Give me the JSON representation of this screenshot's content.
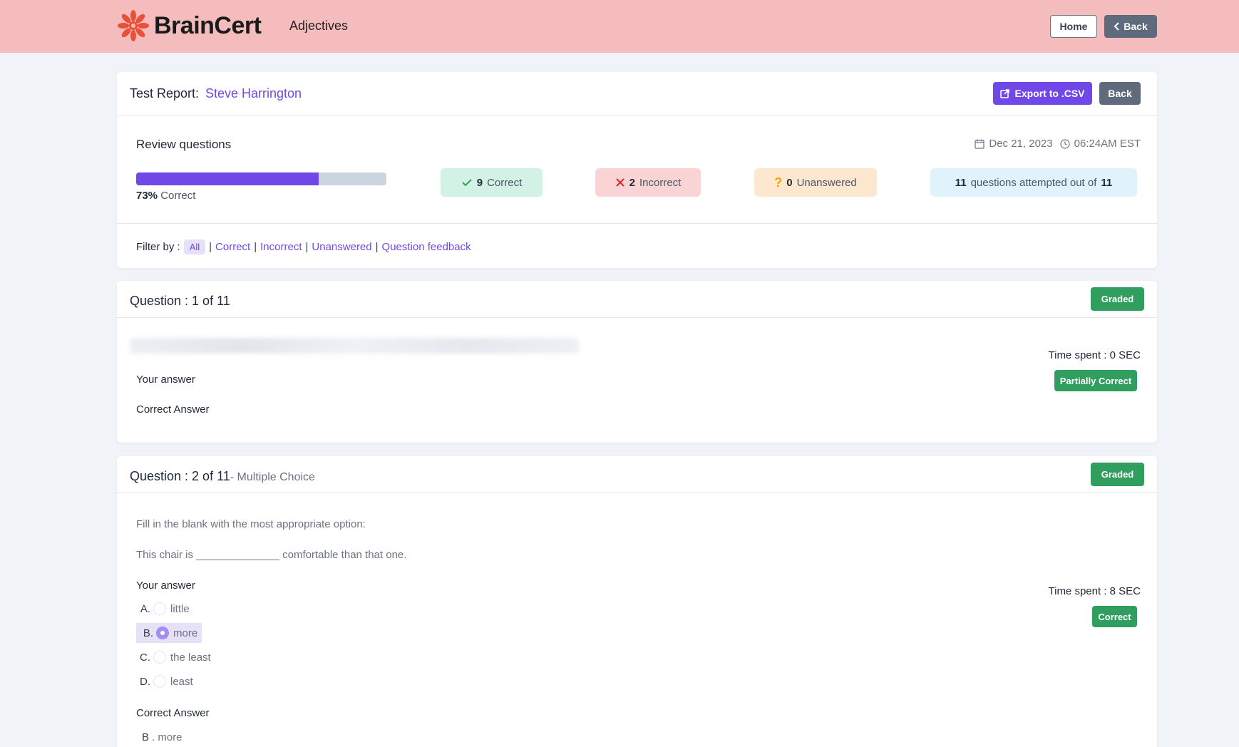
{
  "header": {
    "logo_text": "BrainCert",
    "course_title": "Adjectives",
    "home_label": "Home",
    "back_label": "Back"
  },
  "report": {
    "label": "Test Report:",
    "student_name": "Steve Harrington",
    "export_label": "Export to .CSV",
    "back_label": "Back",
    "review_title": "Review questions",
    "date": "Dec 21, 2023",
    "time": "06:24AM EST",
    "progress_fraction": 0.73,
    "percent": "73%",
    "percent_suffix": "Correct",
    "stats": {
      "correct_count": "9",
      "correct_label": "Correct",
      "incorrect_count": "2",
      "incorrect_label": "Incorrect",
      "unanswered_count": "0",
      "unanswered_label": "Unanswered",
      "attempted_count": "11",
      "attempted_text": "questions attempted out of",
      "total": "11"
    },
    "filter": {
      "label": "Filter by :",
      "all": "All",
      "correct": "Correct",
      "incorrect": "Incorrect",
      "unanswered": "Unanswered",
      "feedback": "Question feedback"
    }
  },
  "questions": [
    {
      "title": "Question : 1 of 11",
      "badge": "Graded",
      "time_spent": "Time spent : 0 SEC",
      "status": "Partially Correct",
      "your_answer_label": "Your answer",
      "correct_answer_label": "Correct Answer"
    },
    {
      "title": "Question : 2 of 11",
      "type": "- Multiple Choice",
      "badge": "Graded",
      "instruction": "Fill in the blank with the most appropriate option:",
      "sentence": "This chair is ______________ comfortable than that one.",
      "time_spent": "Time spent : 8 SEC",
      "status": "Correct",
      "your_answer_label": "Your answer",
      "options": [
        {
          "letter": "A.",
          "text": "little"
        },
        {
          "letter": "B.",
          "text": "more"
        },
        {
          "letter": "C.",
          "text": "the least"
        },
        {
          "letter": "D.",
          "text": "least"
        }
      ],
      "selected_option": "B.",
      "correct_answer_label": "Correct Answer",
      "correct_answer_letter": "B",
      "correct_answer_text": ". more"
    }
  ],
  "colors": {
    "topbar": "#f4bcbc",
    "accent": "#7048e8",
    "success": "#2f9e5f",
    "secondary": "#5f6b7c"
  }
}
